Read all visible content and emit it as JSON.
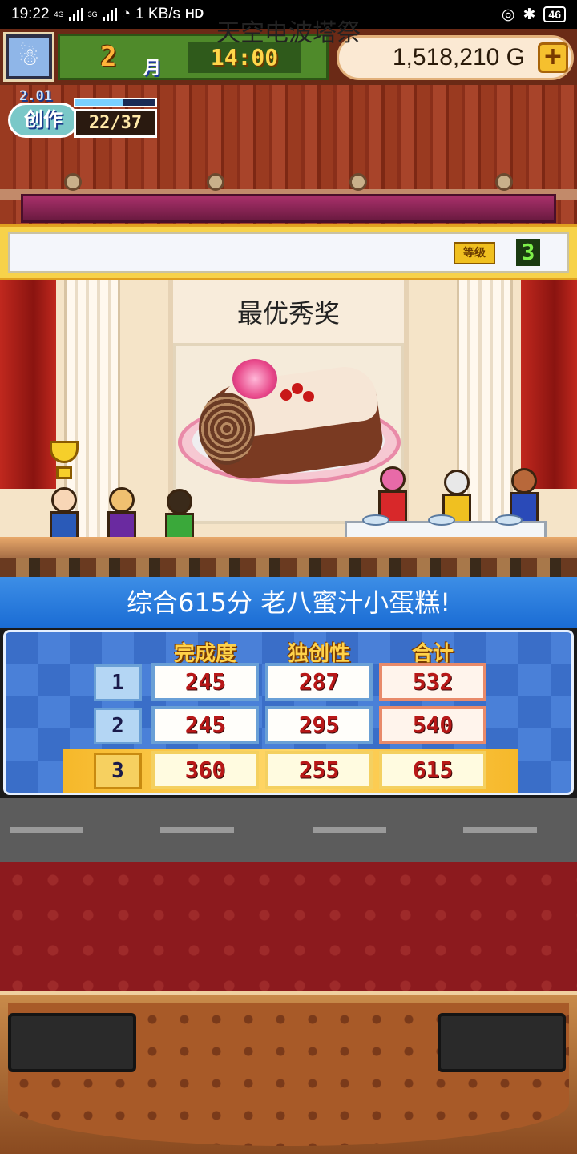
{
  "status_bar": {
    "time": "19:22",
    "net1": "4G",
    "net2": "3G",
    "speed": "1 KB/s",
    "hd": "HD",
    "battery": "46"
  },
  "hud": {
    "month_num": "2",
    "month_label": "月",
    "clock": "14:00",
    "gold": "1,518,210 G",
    "gold_plus": "+"
  },
  "create_badge": {
    "level": "2.01",
    "label": "创作",
    "progress": "22/37",
    "progress_fraction": 0.59
  },
  "event": {
    "title": "天空电波塔祭",
    "grade_label": "等级",
    "grade": "3"
  },
  "stage": {
    "award": "最优秀奖"
  },
  "score_header": "综合615分 老八蜜汁小蛋糕!",
  "score_table": {
    "columns": [
      "完成度",
      "独创性",
      "合计"
    ],
    "rows": [
      {
        "round": "1",
        "completion": "245",
        "originality": "287",
        "total": "532"
      },
      {
        "round": "2",
        "completion": "245",
        "originality": "295",
        "total": "540"
      },
      {
        "round": "3",
        "completion": "360",
        "originality": "255",
        "total": "615"
      }
    ]
  },
  "colors": {
    "header_blue": "#1a6cd4",
    "gold_accent": "#ffd24a",
    "score_red": "#b81818"
  }
}
